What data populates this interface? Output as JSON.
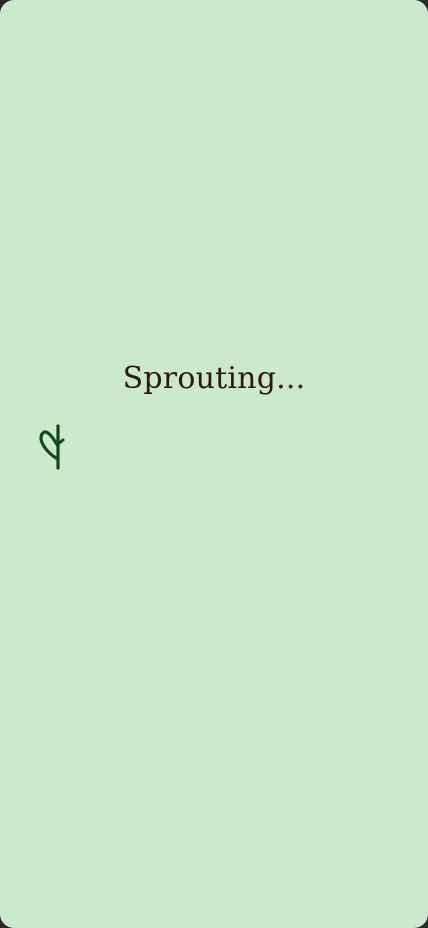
{
  "loader": {
    "text": "Sprouting...",
    "icon": "sprout-icon"
  },
  "colors": {
    "background": "#cde9cd",
    "text": "#2a1a10",
    "icon": "#0e4a1e"
  }
}
